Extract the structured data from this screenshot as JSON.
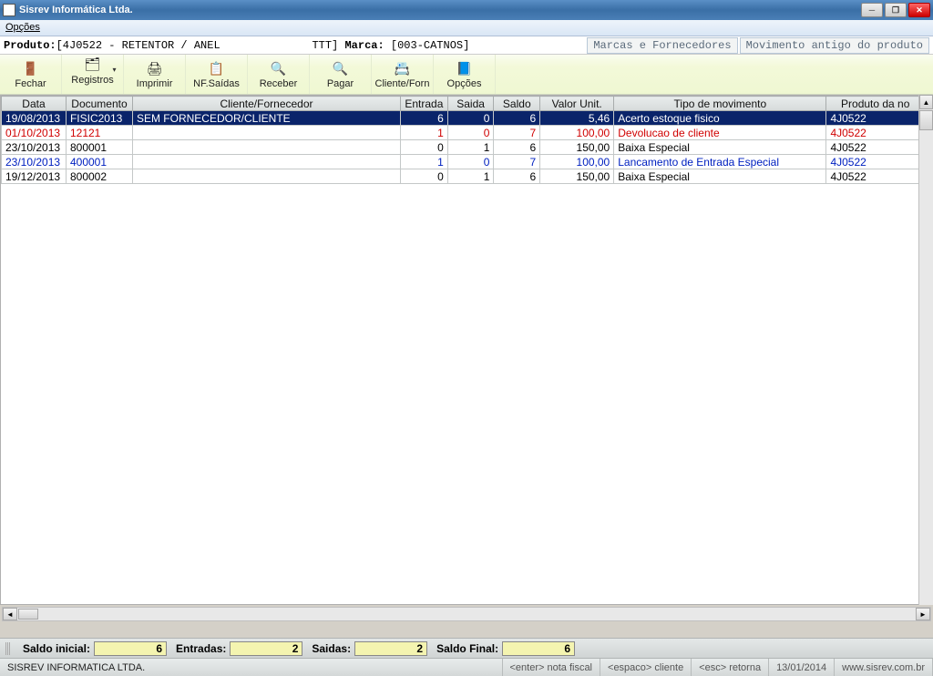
{
  "title": "Sisrev Informática Ltda.",
  "menu": {
    "opcoes": "Opções"
  },
  "info": {
    "produto_label": "Produto:",
    "produto_val": "[4J0522 - RETENTOR / ANEL              TTT]",
    "marca_label": "Marca:",
    "marca_val": "[003-CATNOS]",
    "tab1": "Marcas e Fornecedores",
    "tab2": "Movimento antigo do produto"
  },
  "toolbar": [
    {
      "label": "Fechar",
      "icon": "🚪"
    },
    {
      "label": "Registros",
      "icon": "🗂"
    },
    {
      "label": "Imprimir",
      "icon": "🖨"
    },
    {
      "label": "NF.Saídas",
      "icon": "📋"
    },
    {
      "label": "Receber",
      "icon": "🔍"
    },
    {
      "label": "Pagar",
      "icon": "🔍"
    },
    {
      "label": "Cliente/Forn",
      "icon": "📇"
    },
    {
      "label": "Opções",
      "icon": "📘"
    }
  ],
  "columns": [
    "Data",
    "Documento",
    "Cliente/Fornecedor",
    "Entrada",
    "Saida",
    "Saldo",
    "Valor Unit.",
    "Tipo de movimento",
    "Produto da no"
  ],
  "rows": [
    {
      "cls": "row-sel",
      "data": "19/08/2013",
      "doc": "FISIC2013",
      "cli": "SEM FORNECEDOR/CLIENTE",
      "ent": "6",
      "sai": "0",
      "sal": "6",
      "val": "5,46",
      "tipo": "Acerto estoque fisico",
      "prod": "4J0522"
    },
    {
      "cls": "row-red",
      "data": "01/10/2013",
      "doc": "12121",
      "cli": "",
      "ent": "1",
      "sai": "0",
      "sal": "7",
      "val": "100,00",
      "tipo": "Devolucao de cliente",
      "prod": "4J0522"
    },
    {
      "cls": "",
      "data": "23/10/2013",
      "doc": "800001",
      "cli": "",
      "ent": "0",
      "sai": "1",
      "sal": "6",
      "val": "150,00",
      "tipo": "Baixa Especial",
      "prod": "4J0522"
    },
    {
      "cls": "row-blue",
      "data": "23/10/2013",
      "doc": "400001",
      "cli": "",
      "ent": "1",
      "sai": "0",
      "sal": "7",
      "val": "100,00",
      "tipo": "Lancamento de Entrada Especial",
      "prod": "4J0522"
    },
    {
      "cls": "",
      "data": "19/12/2013",
      "doc": "800002",
      "cli": "",
      "ent": "0",
      "sai": "1",
      "sal": "6",
      "val": "150,00",
      "tipo": "Baixa Especial",
      "prod": "4J0522"
    }
  ],
  "saldo": {
    "inicial_lbl": "Saldo inicial:",
    "inicial": "6",
    "entradas_lbl": "Entradas:",
    "entradas": "2",
    "saidas_lbl": "Saidas:",
    "saidas": "2",
    "final_lbl": "Saldo Final:",
    "final": "6"
  },
  "status": {
    "company": "SISREV INFORMATICA LTDA.",
    "hint1": "<enter> nota fiscal",
    "hint2": "<espaco> cliente",
    "hint3": "<esc> retorna",
    "date": "13/01/2014",
    "url": "www.sisrev.com.br"
  }
}
